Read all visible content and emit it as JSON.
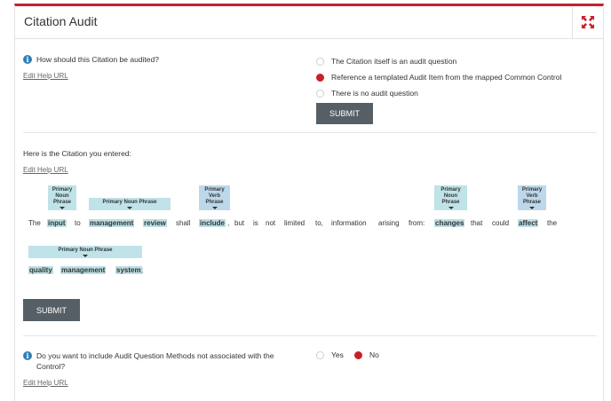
{
  "header": {
    "title": "Citation Audit",
    "expand_icon": "expand-arrows-icon",
    "accent": "#c8202a"
  },
  "audit_section": {
    "question": "How should this Citation be audited?",
    "help_link": "Edit Help URL",
    "options": [
      {
        "label": "The Citation itself is an audit question",
        "checked": false
      },
      {
        "label": "Reference a templated Audit Item from the mapped Common Control",
        "checked": true
      },
      {
        "label": "There is no audit question",
        "checked": false
      }
    ],
    "submit_label": "SUBMIT"
  },
  "citation_section": {
    "intro": "Here is the Citation you entered:",
    "help_link": "Edit Help URL",
    "tags": {
      "input": "Primary Noun Phrase",
      "management_review": "Primary Noun Phrase",
      "include": "Primary Verb Phrase",
      "changes": "Primary Noun Phrase",
      "affect": "Primary Verb Phrase",
      "qms": "Primary Noun Phrase"
    },
    "words": {
      "w1": "The",
      "w2": "input",
      "w3": "to",
      "w4": "management",
      "w5": "review",
      "w6": "shall",
      "w7": "include",
      "w8": ",",
      "w9": "but",
      "w10": "is",
      "w11": "not",
      "w12": "limited",
      "w13": "to,",
      "w14": "information",
      "w15": "arising",
      "w16": "from:",
      "w17": "changes",
      "w18": "that",
      "w19": "could",
      "w20": "affect",
      "w21": "the",
      "w22": "quality",
      "w23": "management",
      "w24": "system",
      "w25": ";"
    },
    "submit_label": "SUBMIT"
  },
  "methods_section": {
    "question": "Do you want to include Audit Question Methods not associated with the Control?",
    "help_link": "Edit Help URL",
    "options": [
      {
        "label": "Yes",
        "checked": false
      },
      {
        "label": "No",
        "checked": true
      }
    ]
  }
}
